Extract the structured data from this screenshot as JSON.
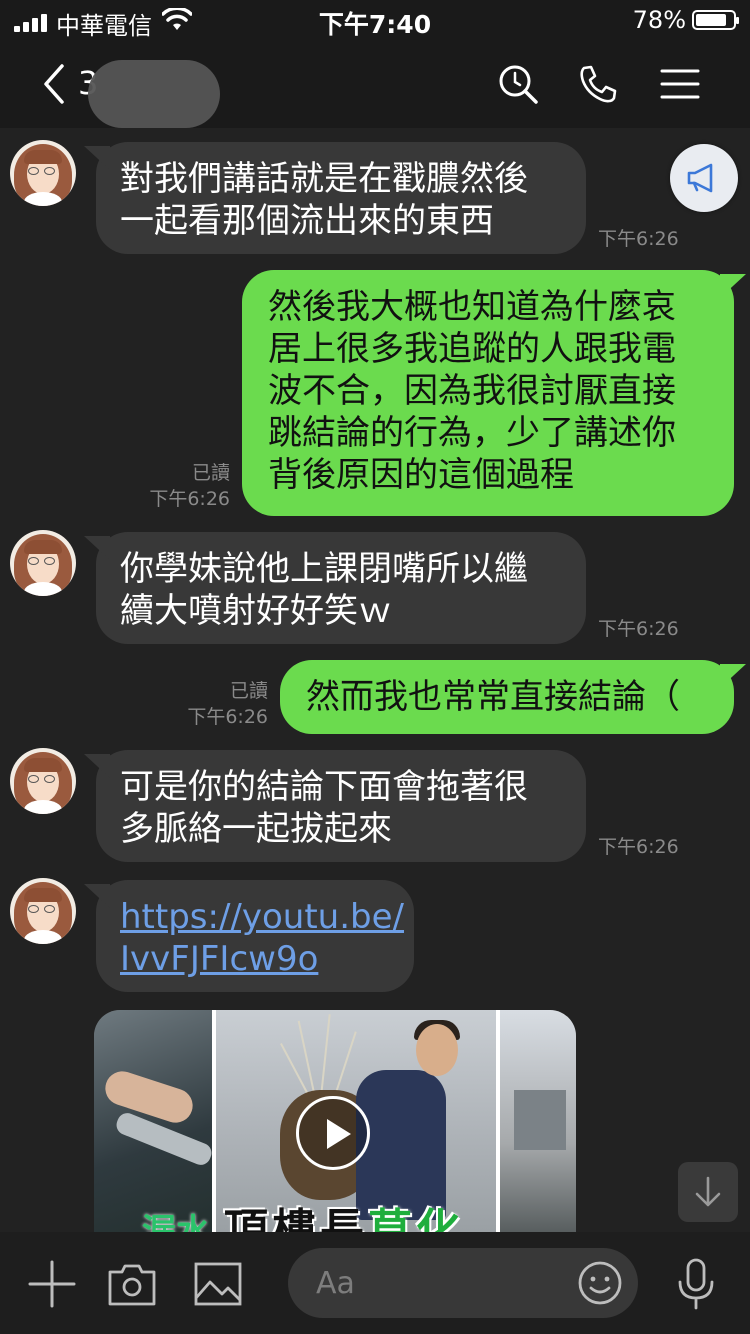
{
  "status_bar": {
    "carrier": "中華電信",
    "time": "下午7:40",
    "battery": "78%",
    "battery_level": 0.78
  },
  "header": {
    "title_visible_fragment": "3",
    "icons": [
      "back-chevron-icon",
      "search-icon",
      "phone-icon",
      "menu-icon"
    ]
  },
  "messages": [
    {
      "side": "in",
      "lines": [
        "對我們講話就是在戳膿然後",
        "一起看那個流出來的東西"
      ],
      "time": "下午6:26"
    },
    {
      "side": "out",
      "lines": [
        "然後我大概也知道為什麼哀",
        "居上很多我追蹤的人跟我電",
        "波不合，因為我很討厭直接",
        "跳結論的行為，少了講述你",
        "背後原因的這個過程"
      ],
      "read": "已讀",
      "time": "下午6:26"
    },
    {
      "side": "in",
      "lines": [
        "你學妹說他上課閉嘴所以繼",
        "續大噴射好好笑ｗ"
      ],
      "time": "下午6:26"
    },
    {
      "side": "out",
      "lines": [
        "然而我也常常直接結論（"
      ],
      "read": "已讀",
      "time": "下午6:26"
    },
    {
      "side": "in",
      "lines": [
        "可是你的結論下面會拖著很",
        "多脈絡一起拔起來"
      ],
      "time": "下午6:26"
    },
    {
      "side": "in",
      "lines": [
        "https://youtu.be/",
        "IvvFJFIcw9o"
      ],
      "is_link": true
    }
  ],
  "video_preview": {
    "caption_left": "漏水",
    "caption_main": "頂樓長",
    "caption_green": "草",
    "caption_tail": "化"
  },
  "input": {
    "placeholder": "Aa"
  },
  "colors": {
    "background": "#222222",
    "incoming_bubble": "#383838",
    "outgoing_bubble": "#6bdb4e",
    "link": "#6e9fe6",
    "meta_text": "#8a8a8a"
  }
}
